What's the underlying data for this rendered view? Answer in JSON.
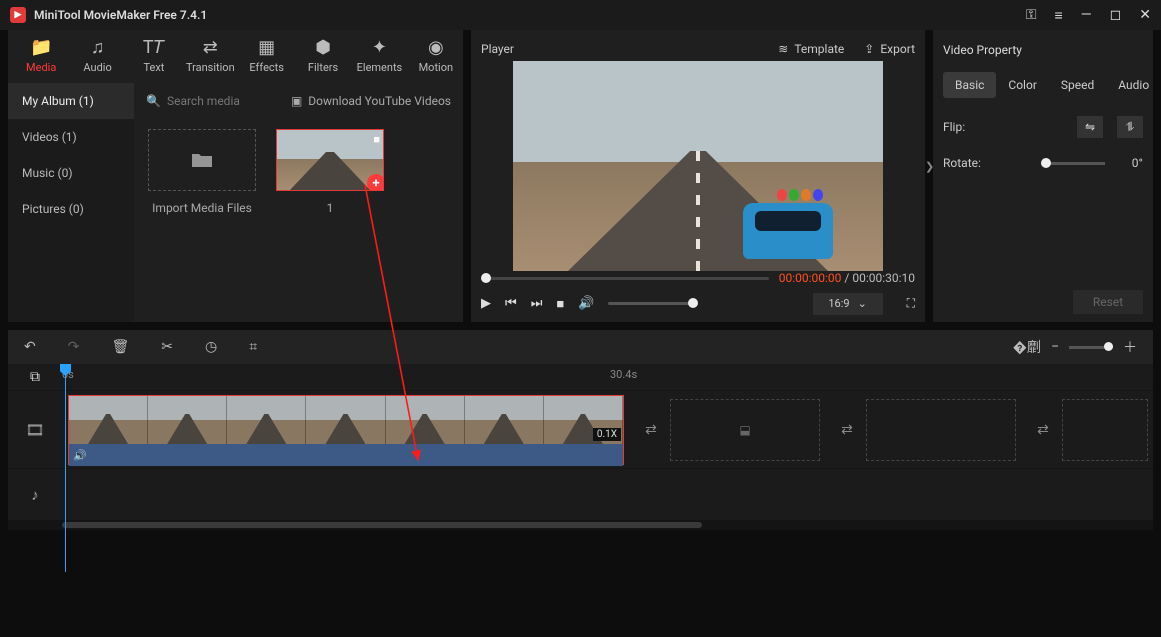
{
  "app": {
    "title": "MiniTool MovieMaker Free 7.4.1"
  },
  "toolTabs": [
    {
      "label": "Media",
      "icon": "folder"
    },
    {
      "label": "Audio",
      "icon": "music"
    },
    {
      "label": "Text",
      "icon": "text"
    },
    {
      "label": "Transition",
      "icon": "transition"
    },
    {
      "label": "Effects",
      "icon": "effects"
    },
    {
      "label": "Filters",
      "icon": "filters"
    },
    {
      "label": "Elements",
      "icon": "elements"
    },
    {
      "label": "Motion",
      "icon": "motion"
    }
  ],
  "mediaSidebar": [
    {
      "label": "My Album (1)"
    },
    {
      "label": "Videos (1)"
    },
    {
      "label": "Music (0)"
    },
    {
      "label": "Pictures (0)"
    }
  ],
  "mediaTop": {
    "searchPlaceholder": "Search media",
    "dlLabel": "Download YouTube Videos"
  },
  "mediaItems": {
    "importLabel": "Import Media Files",
    "clip1Label": "1"
  },
  "player": {
    "title": "Player",
    "template": "Template",
    "export": "Export",
    "current": "00:00:00:00",
    "sep": " / ",
    "total": "00:00:30:10",
    "aspect": "16:9"
  },
  "property": {
    "title": "Video Property",
    "tabs": [
      "Basic",
      "Color",
      "Speed",
      "Audio"
    ],
    "flip": "Flip:",
    "rotate": "Rotate:",
    "rotateVal": "0°",
    "reset": "Reset"
  },
  "timeline": {
    "t0": "0s",
    "t1": "30.4s",
    "rate": "0.1X"
  }
}
